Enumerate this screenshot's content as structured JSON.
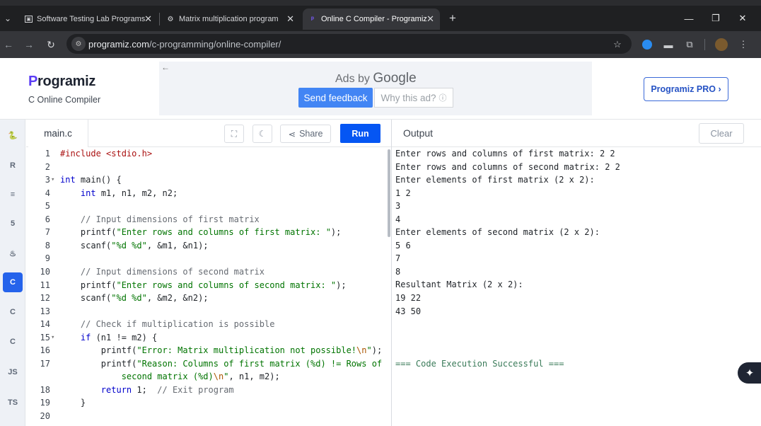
{
  "browser": {
    "tabs": [
      {
        "title": "Software Testing Lab Programs",
        "icon": "document-icon",
        "active": false
      },
      {
        "title": "Matrix multiplication program",
        "icon": "openai-icon",
        "active": false
      },
      {
        "title": "Online C Compiler - Programiz",
        "icon": "programiz-icon",
        "active": true
      }
    ],
    "url_domain": "programiz.com",
    "url_path": "/c-programming/online-compiler/"
  },
  "header": {
    "logo_text": "rogramiz",
    "logo_letter": "P",
    "subtitle": "C Online Compiler",
    "ads_by": "Ads by",
    "ads_brand": "Google",
    "send_feedback": "Send feedback",
    "why_ad": "Why this ad?",
    "pro_button": "Programiz PRO ›"
  },
  "sidebar": {
    "languages": [
      {
        "name": "python",
        "glyph": "🐍"
      },
      {
        "name": "r",
        "glyph": "R"
      },
      {
        "name": "sql",
        "glyph": "≡"
      },
      {
        "name": "html",
        "glyph": "5"
      },
      {
        "name": "java",
        "glyph": "♨"
      },
      {
        "name": "c",
        "glyph": "C",
        "active": true
      },
      {
        "name": "cpp",
        "glyph": "C"
      },
      {
        "name": "csharp",
        "glyph": "C"
      },
      {
        "name": "javascript",
        "glyph": "JS"
      },
      {
        "name": "typescript",
        "glyph": "TS"
      }
    ]
  },
  "editor": {
    "filename": "main.c",
    "share_label": "Share",
    "run_label": "Run",
    "lines": [
      {
        "n": "1",
        "fold": "",
        "html": "<span class='inc'>#include &lt;stdio.h&gt;</span>"
      },
      {
        "n": "2",
        "fold": "",
        "html": ""
      },
      {
        "n": "3",
        "fold": "▾",
        "html": "<span class='kw'>int</span> main() {"
      },
      {
        "n": "4",
        "fold": "",
        "html": "    <span class='kw'>int</span> m1, n1, m2, n2;"
      },
      {
        "n": "5",
        "fold": "",
        "html": ""
      },
      {
        "n": "6",
        "fold": "",
        "html": "    <span class='cm'>// Input dimensions of first matrix</span>"
      },
      {
        "n": "7",
        "fold": "",
        "html": "    printf(<span class='str'>\"Enter rows and columns of first matrix: \"</span>);"
      },
      {
        "n": "8",
        "fold": "",
        "html": "    scanf(<span class='str'>\"%d %d\"</span>, &amp;m1, &amp;n1);"
      },
      {
        "n": "9",
        "fold": "",
        "html": ""
      },
      {
        "n": "10",
        "fold": "",
        "html": "    <span class='cm'>// Input dimensions of second matrix</span>"
      },
      {
        "n": "11",
        "fold": "",
        "html": "    printf(<span class='str'>\"Enter rows and columns of second matrix: \"</span>);"
      },
      {
        "n": "12",
        "fold": "",
        "html": "    scanf(<span class='str'>\"%d %d\"</span>, &amp;m2, &amp;n2);"
      },
      {
        "n": "13",
        "fold": "",
        "html": ""
      },
      {
        "n": "14",
        "fold": "",
        "html": "    <span class='cm'>// Check if multiplication is possible</span>"
      },
      {
        "n": "15",
        "fold": "▾",
        "html": "    <span class='kw'>if</span> (n1 != m2) {"
      },
      {
        "n": "16",
        "fold": "",
        "html": "        printf(<span class='str'>\"Error: Matrix multiplication not possible!<span class='esc'>\\n</span>\"</span>);"
      },
      {
        "n": "17",
        "fold": "",
        "html": "        printf(<span class='str'>\"Reason: Columns of first matrix (%d) != Rows of</span>"
      },
      {
        "n": "",
        "fold": "",
        "html": "            <span class='str'>second matrix (%d)<span class='esc'>\\n</span>\"</span>, n1, m2);"
      },
      {
        "n": "18",
        "fold": "",
        "html": "        <span class='kw'>return</span> 1;  <span class='cm'>// Exit program</span>"
      },
      {
        "n": "19",
        "fold": "",
        "html": "    }"
      },
      {
        "n": "20",
        "fold": "",
        "html": ""
      }
    ]
  },
  "output": {
    "title": "Output",
    "clear_label": "Clear",
    "lines": [
      "Enter rows and columns of first matrix: 2 2",
      "Enter rows and columns of second matrix: 2 2",
      "Enter elements of first matrix (2 x 2):",
      "1 2",
      "3",
      "4",
      "Enter elements of second matrix (2 x 2):",
      "5 6",
      "7",
      "8",
      "Resultant Matrix (2 x 2):",
      "19 22",
      "43 50",
      "",
      "",
      "",
      "=== Code Execution Successful ==="
    ]
  }
}
